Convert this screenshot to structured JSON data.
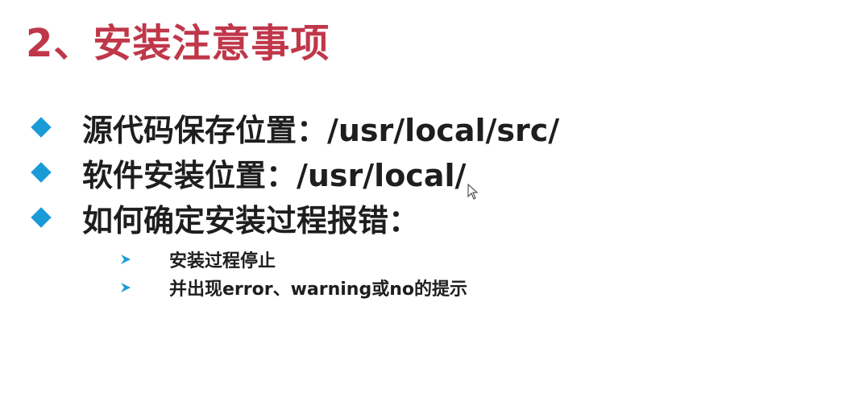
{
  "slide": {
    "title": "2、安装注意事项",
    "bullets": [
      "源代码保存位置：/usr/local/src/",
      "软件安装位置：/usr/local/",
      "如何确定安装过程报错："
    ],
    "sub_bullets": [
      "安装过程停止",
      "并出现error、warning或no的提示"
    ]
  },
  "colors": {
    "title": "#c0374a",
    "bullet_marker": "#1a9bd8",
    "text": "#1e1e1e"
  },
  "icons": {
    "bullet": "diamond-bullet-icon",
    "sub_bullet": "arrow-bullet-icon",
    "pointer": "mouse-pointer-icon"
  }
}
